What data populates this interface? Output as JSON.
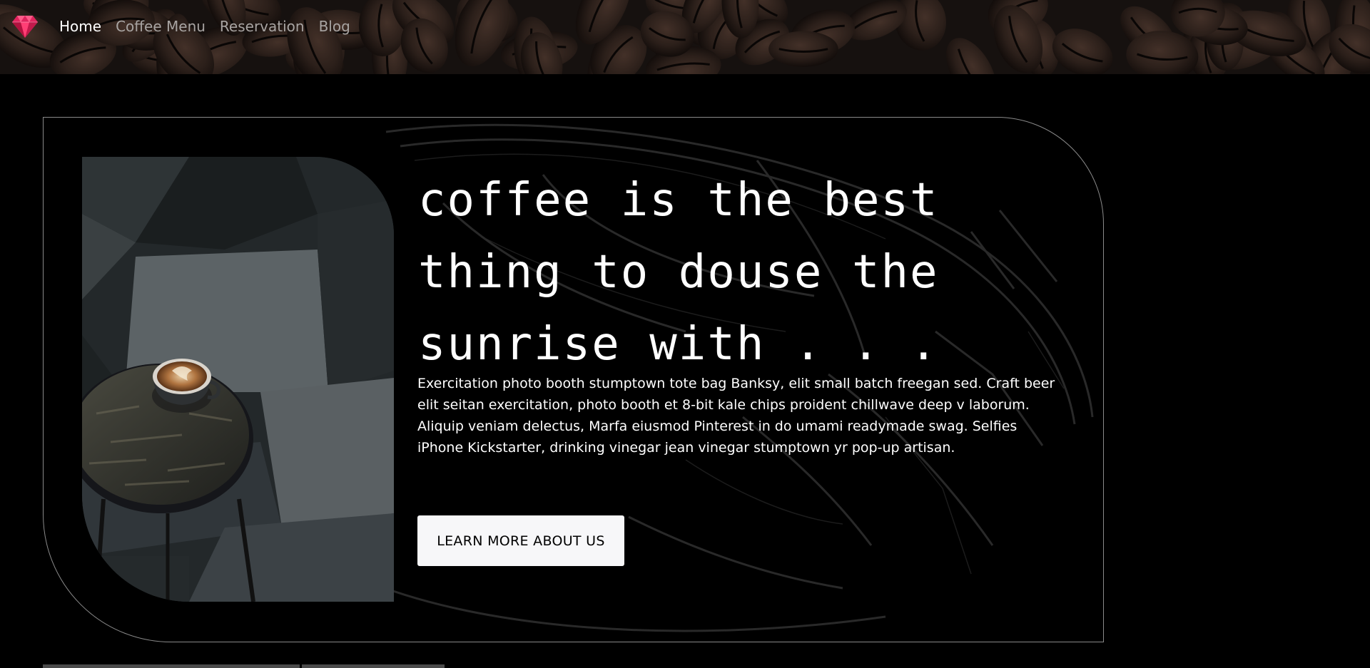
{
  "nav": {
    "logo_icon": "ruby-gem-icon",
    "logo_color": "#e0245e",
    "links": [
      {
        "label": "Home",
        "active": true
      },
      {
        "label": "Coffee Menu",
        "active": false
      },
      {
        "label": "Reservation",
        "active": false
      },
      {
        "label": "Blog",
        "active": false
      }
    ]
  },
  "hero": {
    "headline": "coffee is the best thing to douse the sunrise with . . .",
    "body": "Exercitation photo booth stumptown tote bag Banksy, elit small batch freegan sed. Craft beer elit seitan exercitation, photo booth et 8-bit kale chips proident chillwave deep v laborum. Aliquip veniam delectus, Marfa eiusmod Pinterest in do umami readymade swag. Selfies iPhone Kickstarter, drinking vinegar jean vinegar stumptown yr pop-up artisan.",
    "cta_label": "LEARN MORE ABOUT US"
  },
  "colors": {
    "background": "#000000",
    "nav_active": "#ffffff",
    "nav_inactive": "#a8a4a2",
    "cta_background": "#f7f7f9",
    "card_border": "#8a8a8a"
  }
}
